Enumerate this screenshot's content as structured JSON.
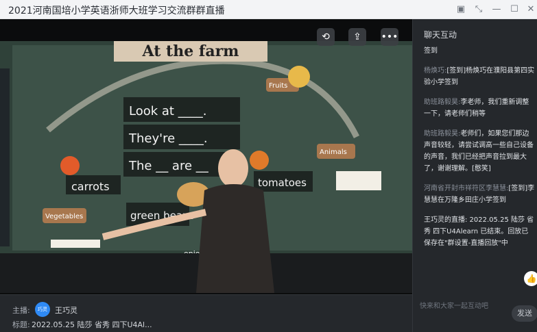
{
  "window": {
    "title": "2021河南国培小学英语浙师大班学习交流群群直播",
    "icons": [
      "screenshot-icon",
      "collapse-icon",
      "minimize-icon",
      "maximize-icon",
      "close-icon"
    ]
  },
  "video": {
    "board_title": "At the farm",
    "board_words": [
      "Look at ____.",
      "They're ____.",
      "The __ are __",
      "carrots",
      "green beans",
      "tomatoes",
      "onions",
      "Vegetables",
      "Fruits",
      "Animals"
    ],
    "controls": [
      "rotate-icon",
      "share-icon",
      "more-icon"
    ]
  },
  "footer": {
    "host_label": "主播:",
    "host_avatar": "巧灵",
    "host_name": "王巧灵",
    "title_label": "标题:",
    "title_value": "2022.05.25 陆莎 省秀 四下U4Al..."
  },
  "chat": {
    "header": "聊天互动",
    "messages": [
      {
        "who": "",
        "text": "签到"
      },
      {
        "who": "杨焕巧:",
        "text": "[签到]杨焕巧在濮阳县第四实验小学签到"
      },
      {
        "who": "助班路毅昊:",
        "text": "李老师，我们重新调整一下，请老师们稍等"
      },
      {
        "who": "助班路毅昊:",
        "text": "老师们，如果您们那边声音较轻，请尝试调高一些自己设备的声音，我们已经把声音拉到最大了，谢谢理解。[憨笑]"
      },
      {
        "who": "河南省开封市祥符区李慧慧:",
        "text": "[签到]李慧慧在万隆乡田庄小学签到"
      },
      {
        "who": "",
        "text": "王巧灵的直播: 2022.05.25 陆莎 省秀 四下U4Alearn 已结束。回放已保存在\"群设置-直播回放\"中"
      }
    ],
    "input_placeholder": "快来和大家一起互动吧",
    "send_label": "发送"
  }
}
